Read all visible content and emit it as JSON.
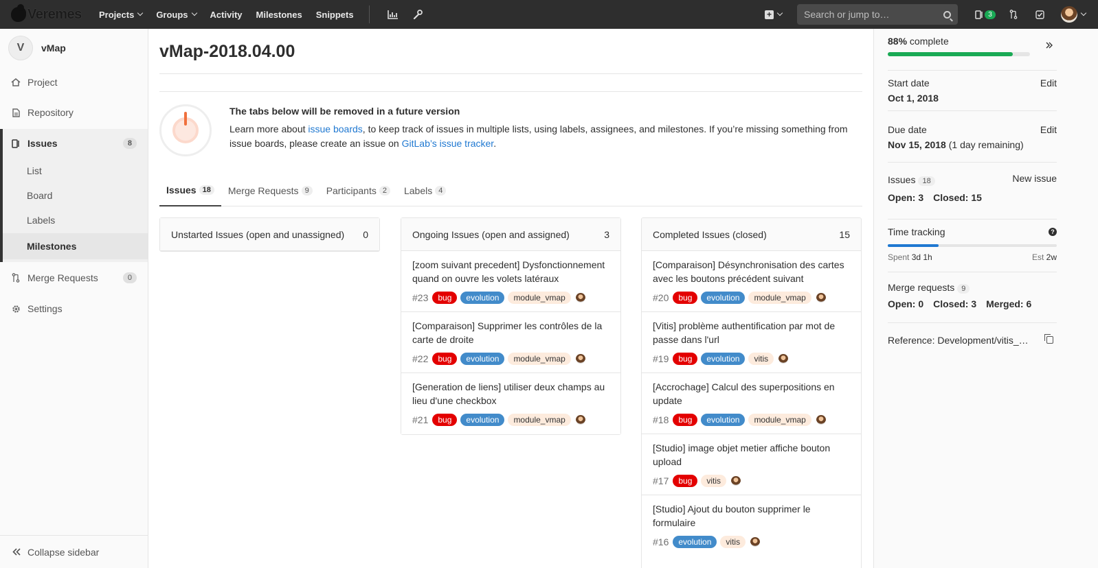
{
  "navbar": {
    "brand": "Veremes",
    "items": [
      "Projects",
      "Groups",
      "Activity",
      "Milestones",
      "Snippets"
    ],
    "search_placeholder": "Search or jump to…",
    "issues_badge": "3",
    "colors": {
      "bg": "#2e2e2e",
      "badge": "#1aaa55"
    }
  },
  "sidebar": {
    "project_initial": "V",
    "project_name": "vMap",
    "items": [
      {
        "label": "Project",
        "icon": "home-icon"
      },
      {
        "label": "Repository",
        "icon": "document-icon"
      },
      {
        "label": "Issues",
        "icon": "issues-icon",
        "count": "8"
      },
      {
        "label": "Merge Requests",
        "icon": "merge-request-icon",
        "count": "0"
      },
      {
        "label": "Settings",
        "icon": "gear-icon"
      }
    ],
    "subitems": [
      "List",
      "Board",
      "Labels",
      "Milestones"
    ],
    "collapse": "Collapse sidebar"
  },
  "main": {
    "title": "vMap-2018.04.00",
    "deprecation": {
      "title": "The tabs below will be removed in a future version",
      "body_1": "Learn more about ",
      "link_1": "issue boards",
      "body_2": ", to keep track of issues in multiple lists, using labels, assignees, and milestones. If you’re missing something from issue boards, please create an issue on ",
      "link_2": "GitLab’s issue tracker",
      "body_3": "."
    },
    "tabs": [
      {
        "label": "Issues",
        "count": "18"
      },
      {
        "label": "Merge Requests",
        "count": "9"
      },
      {
        "label": "Participants",
        "count": "2"
      },
      {
        "label": "Labels",
        "count": "4"
      }
    ],
    "columns": [
      {
        "title": "Unstarted Issues (open and unassigned)",
        "count": "0",
        "issues": []
      },
      {
        "title": "Ongoing Issues (open and assigned)",
        "count": "3",
        "issues": [
          {
            "title": "[zoom suivant precedent] Dysfonctionnement quand on ouvre les volets latéraux",
            "num": "#23",
            "labels": [
              "bug",
              "evolution",
              "module_vmap"
            ]
          },
          {
            "title": "[Comparaison] Supprimer les contrôles de la carte de droite",
            "num": "#22",
            "labels": [
              "bug",
              "evolution",
              "module_vmap"
            ]
          },
          {
            "title": "[Generation de liens] utiliser deux champs au lieu d'une checkbox",
            "num": "#21",
            "labels": [
              "bug",
              "evolution",
              "module_vmap"
            ]
          }
        ]
      },
      {
        "title": "Completed Issues (closed)",
        "count": "15",
        "issues": [
          {
            "title": "[Comparaison] Désynchronisation des cartes avec les boutons précédent suivant",
            "num": "#20",
            "labels": [
              "bug",
              "evolution",
              "module_vmap"
            ]
          },
          {
            "title": "[Vitis] problème authentification par mot de passe dans l'url",
            "num": "#19",
            "labels": [
              "bug",
              "evolution",
              "vitis"
            ]
          },
          {
            "title": "[Accrochage] Calcul des superpositions en update",
            "num": "#18",
            "labels": [
              "bug",
              "evolution",
              "module_vmap"
            ]
          },
          {
            "title": "[Studio] image objet metier affiche bouton upload",
            "num": "#17",
            "labels": [
              "bug",
              "vitis"
            ]
          },
          {
            "title": "[Studio] Ajout du bouton supprimer le formulaire",
            "num": "#16",
            "labels": [
              "evolution",
              "vitis"
            ]
          }
        ]
      }
    ]
  },
  "right_sidebar": {
    "progress_percent": "88%",
    "progress_suffix": " complete",
    "progress_value": 0.88,
    "start_label": "Start date",
    "start_value": "Oct 1, 2018",
    "due_label": "Due date",
    "due_value": "Nov 15, 2018",
    "due_remaining": " (1 day remaining)",
    "edit": "Edit",
    "issues_label": "Issues",
    "issues_count": "18",
    "new_issue": "New issue",
    "issues_open": "Open: 3",
    "issues_closed": "Closed: 15",
    "time_label": "Time tracking",
    "time_progress": 0.3,
    "spent_label": "Spent",
    "spent_value": "3d 1h",
    "est_label": "Est",
    "est_value": "2w",
    "mr_label": "Merge requests",
    "mr_count": "9",
    "mr_open": "Open: 0",
    "mr_closed": "Closed: 3",
    "mr_merged": "Merged: 6",
    "reference": "Reference: Development/vitis_…"
  }
}
